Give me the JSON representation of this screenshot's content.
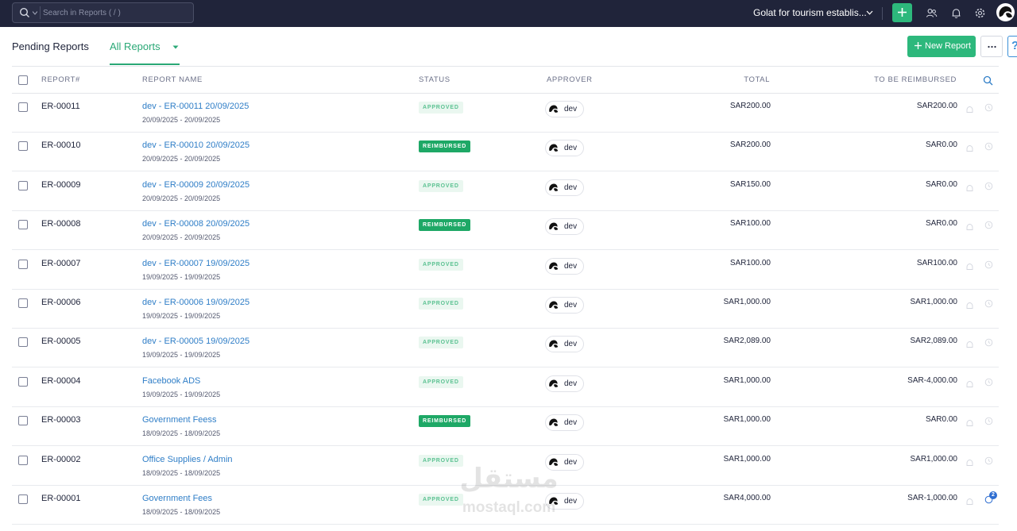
{
  "topbar": {
    "search_placeholder": "Search in Reports ( / )",
    "organization": "Golat for tourism establis..."
  },
  "tabs": {
    "pending": "Pending Reports",
    "all": "All Reports"
  },
  "toolbar": {
    "new_report": "New Report",
    "more": "⋯",
    "help": "?"
  },
  "table": {
    "columns": {
      "report_num": "REPORT#",
      "report_name": "REPORT NAME",
      "status": "STATUS",
      "approver": "APPROVER",
      "total": "TOTAL",
      "to_be_reimbursed": "TO BE REIMBURSED"
    },
    "rows": [
      {
        "num": "ER-00011",
        "name": "dev - ER-00011 20/09/2025",
        "dates": "20/09/2025 - 20/09/2025",
        "status": "APPROVED",
        "approver": "dev",
        "total": "SAR200.00",
        "reimb": "SAR200.00"
      },
      {
        "num": "ER-00010",
        "name": "dev - ER-00010 20/09/2025",
        "dates": "20/09/2025 - 20/09/2025",
        "status": "REIMBURSED",
        "approver": "dev",
        "total": "SAR200.00",
        "reimb": "SAR0.00"
      },
      {
        "num": "ER-00009",
        "name": "dev - ER-00009 20/09/2025",
        "dates": "20/09/2025 - 20/09/2025",
        "status": "APPROVED",
        "approver": "dev",
        "total": "SAR150.00",
        "reimb": "SAR0.00"
      },
      {
        "num": "ER-00008",
        "name": "dev - ER-00008 20/09/2025",
        "dates": "20/09/2025 - 20/09/2025",
        "status": "REIMBURSED",
        "approver": "dev",
        "total": "SAR100.00",
        "reimb": "SAR0.00"
      },
      {
        "num": "ER-00007",
        "name": "dev - ER-00007 19/09/2025",
        "dates": "19/09/2025 - 19/09/2025",
        "status": "APPROVED",
        "approver": "dev",
        "total": "SAR100.00",
        "reimb": "SAR100.00"
      },
      {
        "num": "ER-00006",
        "name": "dev - ER-00006 19/09/2025",
        "dates": "19/09/2025 - 19/09/2025",
        "status": "APPROVED",
        "approver": "dev",
        "total": "SAR1,000.00",
        "reimb": "SAR1,000.00"
      },
      {
        "num": "ER-00005",
        "name": "dev - ER-00005 19/09/2025",
        "dates": "19/09/2025 - 19/09/2025",
        "status": "APPROVED",
        "approver": "dev",
        "total": "SAR2,089.00",
        "reimb": "SAR2,089.00"
      },
      {
        "num": "ER-00004",
        "name": "Facebook ADS",
        "dates": "19/09/2025 - 19/09/2025",
        "status": "APPROVED",
        "approver": "dev",
        "total": "SAR1,000.00",
        "reimb": "SAR-4,000.00"
      },
      {
        "num": "ER-00003",
        "name": "Government Feess",
        "dates": "18/09/2025 - 18/09/2025",
        "status": "REIMBURSED",
        "approver": "dev",
        "total": "SAR1,000.00",
        "reimb": "SAR0.00"
      },
      {
        "num": "ER-00002",
        "name": "Office Supplies / Admin",
        "dates": "18/09/2025 - 18/09/2025",
        "status": "APPROVED",
        "approver": "dev",
        "total": "SAR1,000.00",
        "reimb": "SAR1,000.00"
      },
      {
        "num": "ER-00001",
        "name": "Government Fees",
        "dates": "18/09/2025 - 18/09/2025",
        "status": "APPROVED",
        "approver": "dev",
        "total": "SAR4,000.00",
        "reimb": "SAR-1,000.00",
        "comments": "2"
      }
    ]
  },
  "watermark": {
    "arabic": "مستقل",
    "latin": "mostaql.com"
  },
  "colors": {
    "topbar": "#20243a",
    "accent_green": "#2db87c",
    "link_blue": "#2f7ec7",
    "reimbursed_badge": "#1ea866",
    "approved_badge_text": "#5cc292"
  }
}
